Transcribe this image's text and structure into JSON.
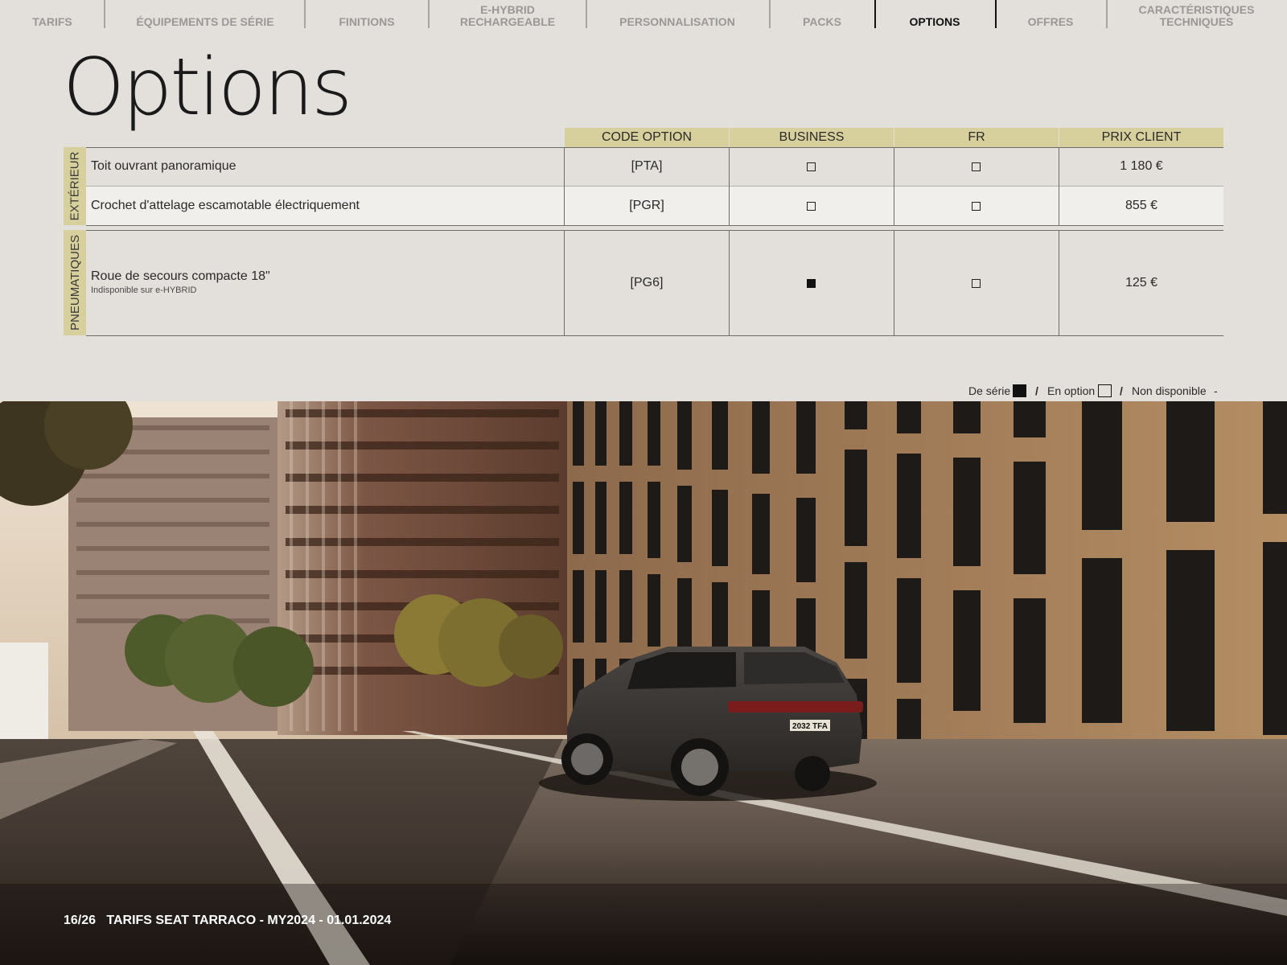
{
  "nav": {
    "items": [
      {
        "label": "TARIFS",
        "active": false
      },
      {
        "label": "ÉQUIPEMENTS DE SÉRIE",
        "active": false
      },
      {
        "label": "FINITIONS",
        "active": false
      },
      {
        "label": "e-HYBRID\nRECHARGEABLE",
        "active": false
      },
      {
        "label": "PERSONNALISATION",
        "active": false
      },
      {
        "label": "PACKS",
        "active": false
      },
      {
        "label": "OPTIONS",
        "active": true
      },
      {
        "label": "OFFRES",
        "active": false
      },
      {
        "label": "CARACTÉRISTIQUES\nTECHNIQUES",
        "active": false
      }
    ]
  },
  "page_title": "Options",
  "table": {
    "headers": [
      "CODE OPTION",
      "BUSINESS",
      "FR",
      "PRIX CLIENT"
    ],
    "categories": [
      {
        "name": "EXTÉRIEUR",
        "rows": [
          {
            "label": "Toit ouvrant panoramique",
            "note": "",
            "code": "[PTA]",
            "business": "option",
            "fr": "option",
            "price": "1 180 €"
          },
          {
            "label": "Crochet d'attelage escamotable électriquement",
            "note": "",
            "code": "[PGR]",
            "business": "option",
            "fr": "option",
            "price": "855 €"
          }
        ]
      },
      {
        "name": "PNEUMATIQUES",
        "rows": [
          {
            "label": "Roue de secours compacte 18\"",
            "note": "Indisponible sur e-HYBRID",
            "code": "[PG6]",
            "business": "standard",
            "fr": "option",
            "price": "125 €"
          }
        ]
      }
    ]
  },
  "legend": {
    "standard": "De série",
    "option": "En option",
    "unavailable": "Non disponible",
    "separator": "/",
    "unavailable_symbol": "-"
  },
  "footer": {
    "page": "16/26",
    "title": "TARIFS SEAT TARRACO - MY2024 - 01.01.2024"
  },
  "photo": {
    "license_plate": "2032 TFA"
  },
  "colors": {
    "background": "#e3e0dc",
    "accent_band": "#d8d09c",
    "text": "#1a1a1a",
    "nav_inactive": "#9a9896"
  }
}
